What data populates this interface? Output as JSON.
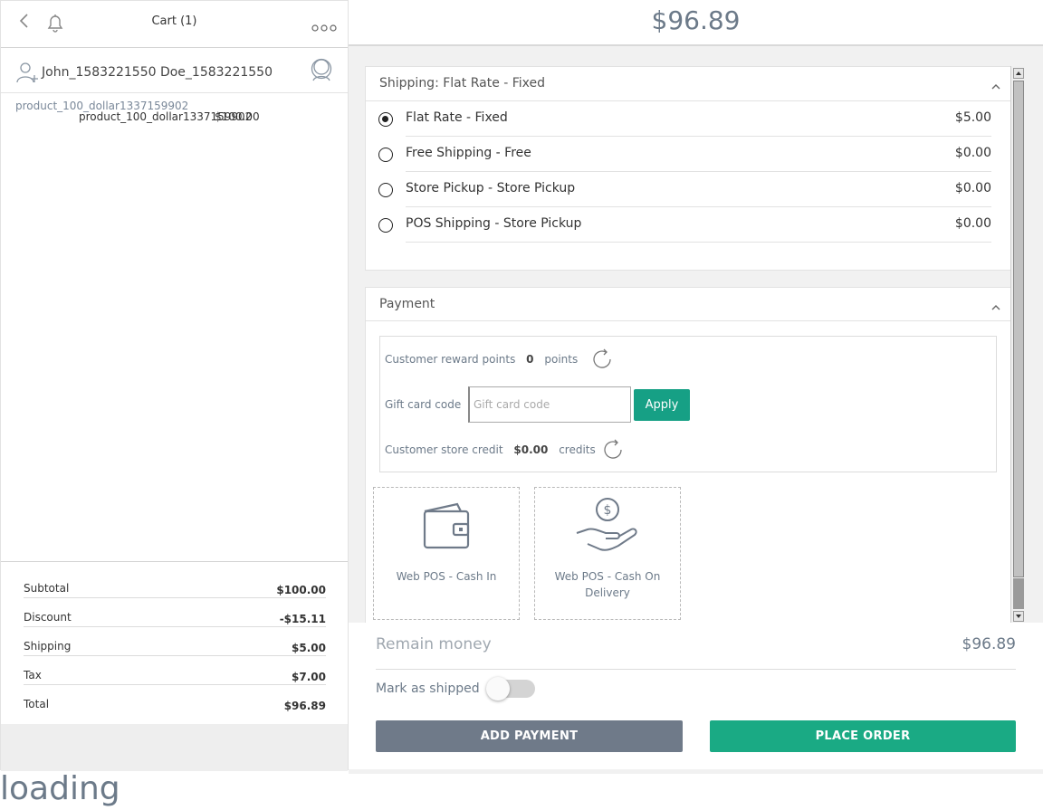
{
  "cart": {
    "title": "Cart (1)",
    "customer_name": "John_1583221550 Doe_1583221550",
    "items": [
      {
        "name": "product_100_dollar1337159902",
        "sub_name": "product_100_dollar1337159902",
        "price": "$100.00"
      }
    ]
  },
  "totals": {
    "subtotal_label": "Subtotal",
    "subtotal": "$100.00",
    "discount_label": "Discount",
    "discount": "-$15.11",
    "shipping_label": "Shipping",
    "shipping": "$5.00",
    "tax_label": "Tax",
    "tax": "$7.00",
    "total_label": "Total",
    "total": "$96.89"
  },
  "checkout": {
    "grand_total": "$96.89",
    "shipping_section_title": "Shipping: Flat Rate - Fixed",
    "shipping_methods": [
      {
        "name": "Flat Rate - Fixed",
        "price": "$5.00",
        "selected": true
      },
      {
        "name": "Free Shipping - Free",
        "price": "$0.00",
        "selected": false
      },
      {
        "name": "Store Pickup - Store Pickup",
        "price": "$0.00",
        "selected": false
      },
      {
        "name": "POS Shipping - Store Pickup",
        "price": "$0.00",
        "selected": false
      }
    ],
    "payment_section_title": "Payment",
    "reward_label": "Customer reward points",
    "reward_value": "0",
    "reward_unit": "points",
    "gift_label": "Gift card code",
    "gift_placeholder": "Gift card code",
    "apply_label": "Apply",
    "credit_label": "Customer store credit",
    "credit_value": "$0.00",
    "credit_unit": "credits",
    "payment_methods": [
      {
        "label": "Web POS - Cash In",
        "icon": "wallet-icon"
      },
      {
        "label": "Web POS - Cash On Delivery",
        "icon": "cash-on-delivery-icon"
      }
    ],
    "remain_label": "Remain money",
    "remain_value": "$96.89",
    "mark_shipped_label": "Mark as shipped",
    "mark_shipped": false,
    "add_payment_label": "ADD PAYMENT",
    "place_order_label": "PLACE ORDER"
  },
  "loading_text": "loading",
  "colors": {
    "accent": "#16a085",
    "gray_button": "#6f7a89",
    "muted_text": "#6c7a89"
  }
}
